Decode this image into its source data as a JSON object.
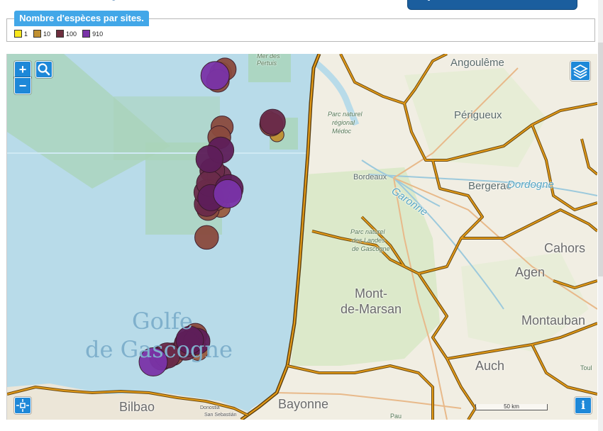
{
  "legend": {
    "title": "Nombre d'espèces par sites.",
    "items": [
      {
        "label": "1",
        "color": "#f8e71c"
      },
      {
        "label": "10",
        "color": "#c09031"
      },
      {
        "label": "100",
        "color": "#6e2e3e"
      },
      {
        "label": "910",
        "color": "#7a33a8"
      }
    ]
  },
  "controls": {
    "zoom_in": "+",
    "zoom_out": "−",
    "info": "i"
  },
  "map": {
    "labels": {
      "angouleme": "Angoulême",
      "perigueux": "Périgueux",
      "bordeaux": "Bordeaux",
      "bergerac": "Bergerac",
      "dordogne": "Dordogne",
      "garonne": "Garonne",
      "mont": "Mont-",
      "marsan": "de-Marsan",
      "agen": "Agen",
      "montauban": "Montauban",
      "auch": "Auch",
      "bayonne": "Bayonne",
      "bilbao": "Bilbao",
      "golfe": "Golfe",
      "gascogne": "de Gascogne",
      "mer1": "Mer des",
      "mer2": "Pertuis",
      "parc_medoc_1": "Parc naturel",
      "parc_medoc_2": "régional",
      "parc_medoc_3": "Médoc",
      "parc_landes_1": "Parc naturel",
      "parc_landes_2": "des Landes",
      "parc_landes_3": "de Gascogne",
      "cahors": "Cahors",
      "toul": "Toul",
      "pau": "Pau",
      "donostia": "Donostia",
      "sebastian": "San Sebastián"
    },
    "scale_label": "50 km",
    "sites": [
      {
        "lon": -1.05,
        "lat": 45.88,
        "count": 120
      },
      {
        "lon": -1.12,
        "lat": 45.83,
        "count": 910
      },
      {
        "lon": -1.08,
        "lat": 45.85,
        "count": 100
      },
      {
        "lon": -1.1,
        "lat": 45.79,
        "count": 130
      },
      {
        "lon": -0.71,
        "lat": 45.47,
        "count": 300
      },
      {
        "lon": -0.72,
        "lat": 45.45,
        "count": 150
      },
      {
        "lon": -0.73,
        "lat": 45.51,
        "count": 2
      },
      {
        "lon": -0.68,
        "lat": 45.37,
        "count": 8
      },
      {
        "lon": -1.07,
        "lat": 45.43,
        "count": 110
      },
      {
        "lon": -1.09,
        "lat": 45.35,
        "count": 140
      },
      {
        "lon": -1.08,
        "lat": 45.25,
        "count": 400
      },
      {
        "lon": -1.16,
        "lat": 45.18,
        "count": 500
      },
      {
        "lon": -1.14,
        "lat": 45.09,
        "count": 250
      },
      {
        "lon": -1.09,
        "lat": 45.04,
        "count": 220
      },
      {
        "lon": -1.16,
        "lat": 44.99,
        "count": 350
      },
      {
        "lon": -1.02,
        "lat": 44.95,
        "count": 700
      },
      {
        "lon": -1.1,
        "lat": 44.92,
        "count": 160
      },
      {
        "lon": -1.14,
        "lat": 44.93,
        "count": 120
      },
      {
        "lon": -1.18,
        "lat": 44.92,
        "count": 300
      },
      {
        "lon": -1.03,
        "lat": 44.91,
        "count": 800
      },
      {
        "lon": -1.11,
        "lat": 44.87,
        "count": 150
      },
      {
        "lon": -1.15,
        "lat": 44.88,
        "count": 400
      },
      {
        "lon": -1.18,
        "lat": 44.83,
        "count": 250
      },
      {
        "lon": -1.08,
        "lat": 44.8,
        "count": 40
      },
      {
        "lon": -1.17,
        "lat": 44.79,
        "count": 120
      },
      {
        "lon": -1.18,
        "lat": 44.57,
        "count": 180
      },
      {
        "lon": -1.26,
        "lat": 43.81,
        "count": 150
      },
      {
        "lon": -1.27,
        "lat": 43.79,
        "count": 140
      },
      {
        "lon": -1.3,
        "lat": 43.77,
        "count": 600
      },
      {
        "lon": -1.25,
        "lat": 43.76,
        "count": 400
      },
      {
        "lon": -1.32,
        "lat": 43.74,
        "count": 300
      },
      {
        "lon": -1.33,
        "lat": 43.71,
        "count": 250
      },
      {
        "lon": -1.24,
        "lat": 43.69,
        "count": 60
      },
      {
        "lon": -1.42,
        "lat": 43.66,
        "count": 120
      },
      {
        "lon": -1.46,
        "lat": 43.65,
        "count": 300
      },
      {
        "lon": -1.5,
        "lat": 43.63,
        "count": 200
      },
      {
        "lon": -1.56,
        "lat": 43.6,
        "count": 910
      }
    ]
  }
}
